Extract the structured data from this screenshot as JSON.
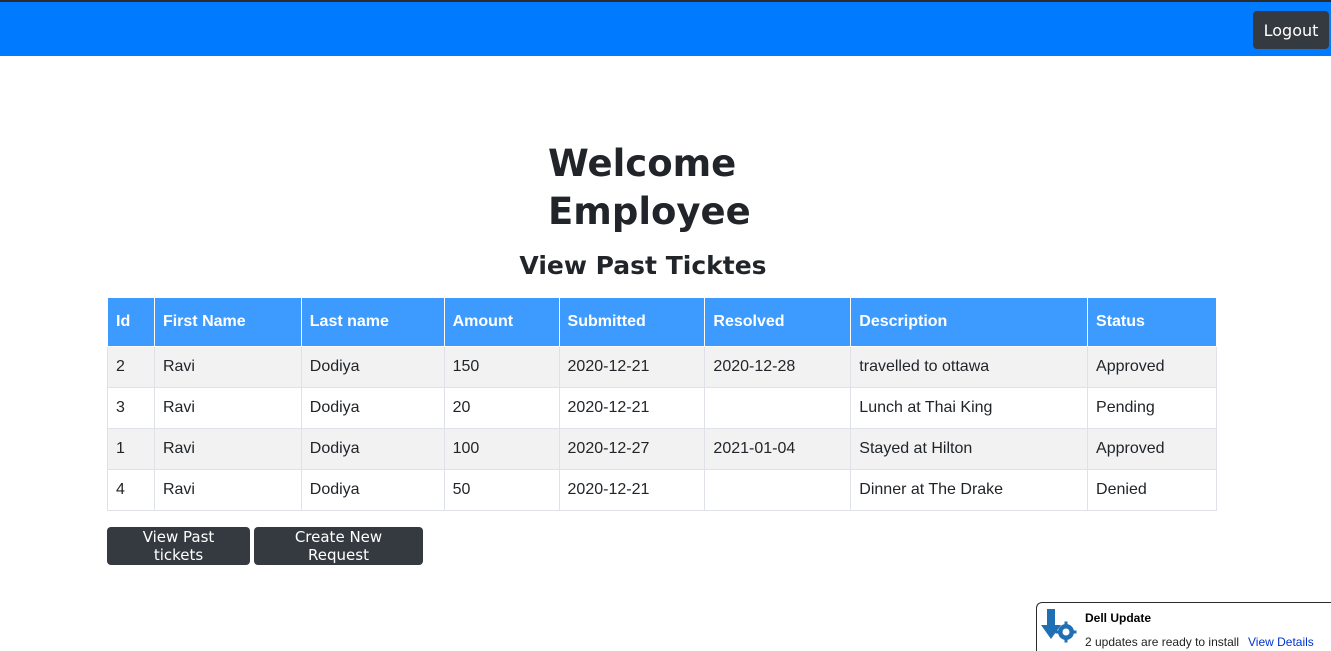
{
  "header": {
    "logout_label": "Logout",
    "bar_color": "#007bff"
  },
  "main": {
    "welcome_line1": "Welcome",
    "welcome_line2": "Employee",
    "subtitle": "View Past Ticktes"
  },
  "table": {
    "columns": [
      "Id",
      "First Name",
      "Last name",
      "Amount",
      "Submitted",
      "Resolved",
      "Description",
      "Status"
    ],
    "rows": [
      [
        "2",
        "Ravi",
        "Dodiya",
        "150",
        "2020-12-21",
        "2020-12-28",
        "travelled to ottawa",
        "Approved"
      ],
      [
        "3",
        "Ravi",
        "Dodiya",
        "20",
        "2020-12-21",
        "",
        "Lunch at Thai King",
        "Pending"
      ],
      [
        "1",
        "Ravi",
        "Dodiya",
        "100",
        "2020-12-27",
        "2021-01-04",
        "Stayed at Hilton",
        "Approved"
      ],
      [
        "4",
        "Ravi",
        "Dodiya",
        "50",
        "2020-12-21",
        "",
        "Dinner at The Drake",
        "Denied"
      ]
    ],
    "header_color": "#3d9bff"
  },
  "actions": {
    "view_past_label": "View Past tickets",
    "create_label": "Create New Request"
  },
  "notification": {
    "title": "Dell Update",
    "message": "2 updates are ready to install",
    "link": "View Details",
    "icon": "dell-update-icon"
  }
}
